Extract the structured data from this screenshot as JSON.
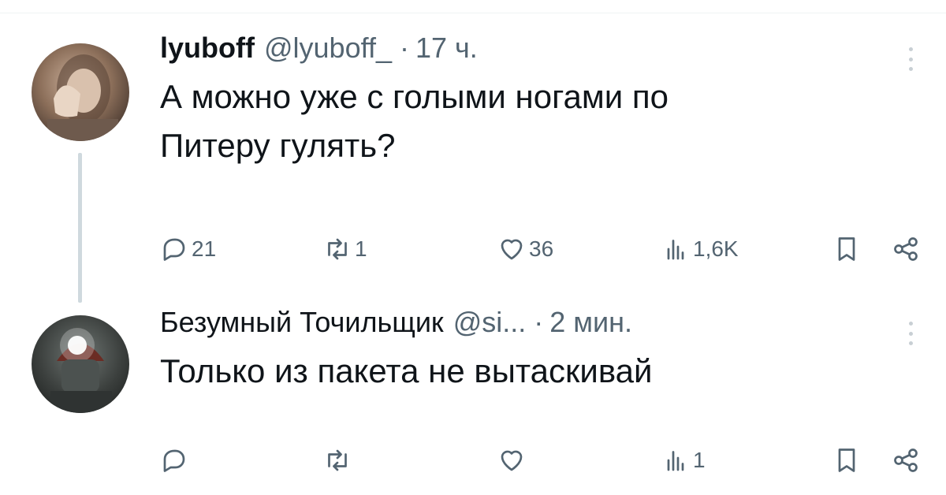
{
  "tweets": [
    {
      "avatar_icon": "user-avatar-photo",
      "name": "lyuboff",
      "handle": "@lyuboff_",
      "separator": "·",
      "time": "17 ч.",
      "text_lines": [
        "А можно уже с голыми ногами по",
        "Питеру гулять?"
      ],
      "actions": {
        "reply": {
          "icon": "reply-icon",
          "count": "21"
        },
        "repost": {
          "icon": "repost-icon",
          "count": "1"
        },
        "like": {
          "icon": "like-icon",
          "count": "36"
        },
        "views": {
          "icon": "views-icon",
          "count": "1,6K"
        },
        "bookmark": {
          "icon": "bookmark-icon"
        },
        "share": {
          "icon": "share-icon"
        }
      }
    },
    {
      "avatar_icon": "user-avatar-photo",
      "name": "Безумный Точильщик",
      "handle": "@si...",
      "separator": "·",
      "time": "2 мин.",
      "text_lines": [
        "Только из пакета не вытаскивай"
      ],
      "actions": {
        "reply": {
          "icon": "reply-icon",
          "count": ""
        },
        "repost": {
          "icon": "repost-icon",
          "count": ""
        },
        "like": {
          "icon": "like-icon",
          "count": ""
        },
        "views": {
          "icon": "views-icon",
          "count": "1"
        },
        "bookmark": {
          "icon": "bookmark-icon"
        },
        "share": {
          "icon": "share-icon"
        }
      }
    }
  ],
  "colors": {
    "text": "#0f1419",
    "secondary": "#536471",
    "thread_line": "#cfd9de"
  }
}
